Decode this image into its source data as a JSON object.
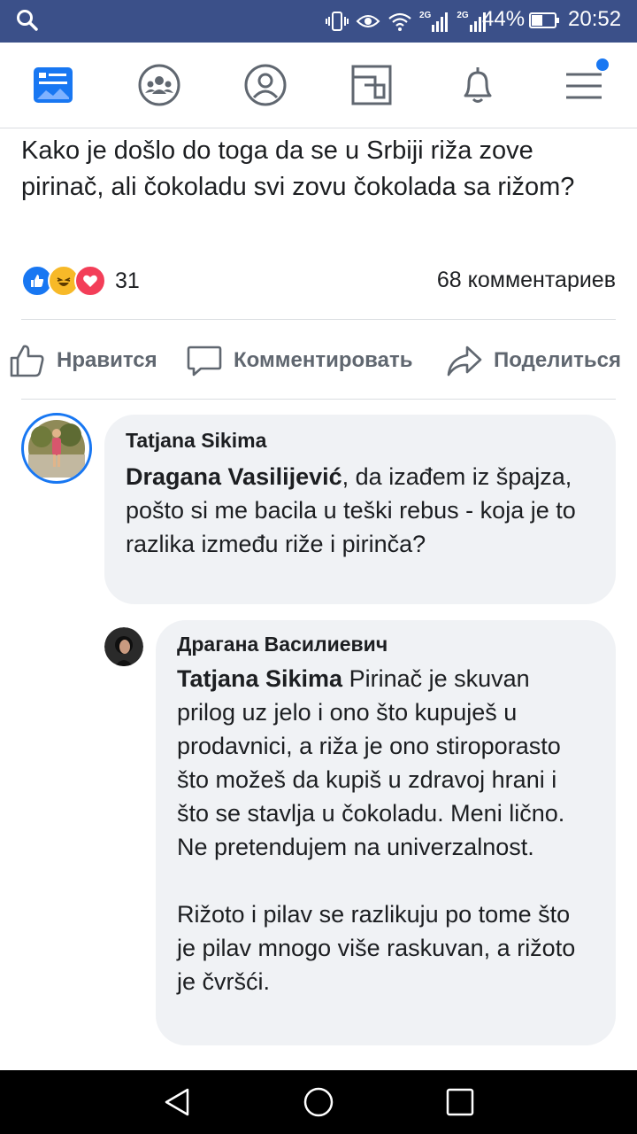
{
  "status_bar": {
    "battery_percent": "44%",
    "time": "20:52",
    "network_1": "2G",
    "network_2": "2G"
  },
  "nav": {
    "items": [
      "news-feed",
      "groups",
      "profile",
      "marketplace",
      "notifications",
      "menu"
    ],
    "active": "news-feed",
    "accent_color": "#1877f2"
  },
  "post": {
    "text": "Kako je došlo do toga da se u Srbiji riža zove pirinač, ali čokoladu svi zovu čokolada sa rižom?",
    "reaction_count": "31",
    "comments_count": "68 комментариев",
    "reactions": [
      "like",
      "haha",
      "love"
    ]
  },
  "actions": {
    "like_label": "Нравится",
    "comment_label": "Комментировать",
    "share_label": "Поделиться"
  },
  "comments": [
    {
      "author": "Tatjana Sikima",
      "mention": "Dragana Vasilijević",
      "text": ", da izađem iz špajza, pošto si me bacila u teški rebus - koja je to razlika između riže i pirinča?"
    },
    {
      "author": "Драгана Василиевич",
      "mention": "Tatjana Sikima",
      "text": " Pirinač je skuvan prilog uz jelo i ono što kupuješ u prodavnici, a riža je ono stiroporasto što možeš da kupiš u zdravoj hrani i što se stavlja u čokoladu. Meni lično. Ne pretendujem na univerzalnost.",
      "text2": "Rižoto i pilav se razlikuju po tome što je pilav mnogo više raskuvan, a rižoto je čvršći."
    }
  ],
  "colors": {
    "status_bar_bg": "#3b5089",
    "bubble_bg": "#f0f2f5",
    "muted_text": "#606770"
  }
}
